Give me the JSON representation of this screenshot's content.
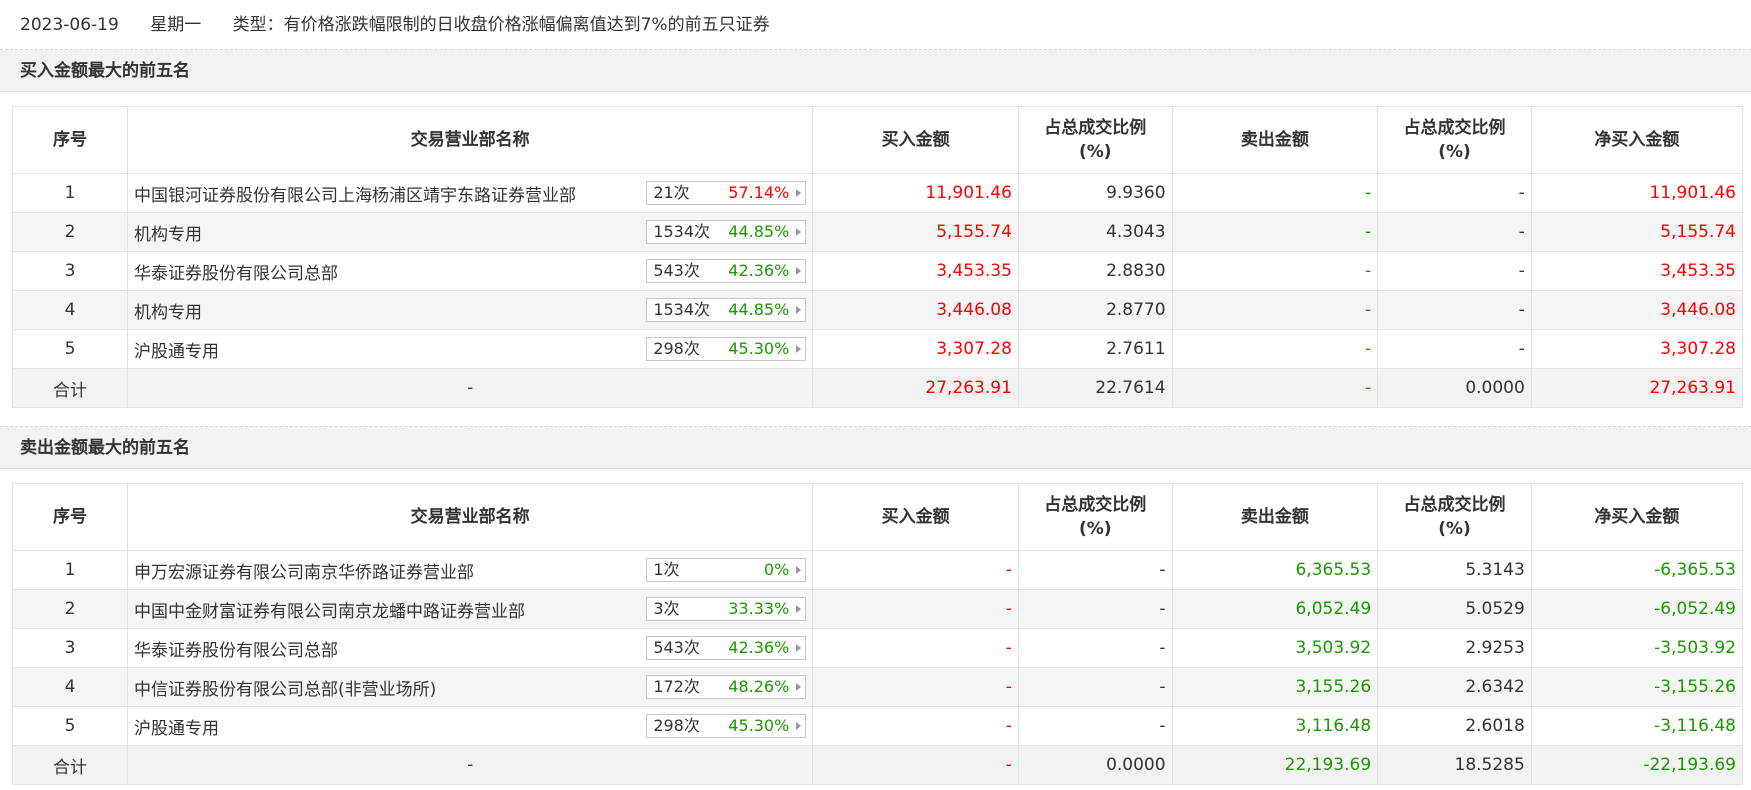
{
  "info": {
    "date": "2023-06-19",
    "weekday": "星期一",
    "type_text": "类型：有价格涨跌幅限制的日收盘价格涨幅偏离值达到7%的前五只证券"
  },
  "buy_section": {
    "title": "买入金额最大的前五名",
    "headers": [
      "序号",
      "交易营业部名称",
      "买入金额",
      "占总成交比例",
      "(%)",
      "卖出金额",
      "占总成交比例",
      "(%)",
      "净买入金额"
    ],
    "rows": [
      {
        "idx": "1",
        "name": "中国银河证券股份有限公司上海杨浦区靖宇东路证券营业部",
        "count": "21次",
        "pct": "57.14%",
        "pct_color": "red",
        "buy": "11,901.46",
        "buy_ratio": "9.9360",
        "sell": "-",
        "sell_ratio": "-",
        "net": "11,901.46"
      },
      {
        "idx": "2",
        "name": "机构专用",
        "count": "1534次",
        "pct": "44.85%",
        "pct_color": "green",
        "buy": "5,155.74",
        "buy_ratio": "4.3043",
        "sell": "-",
        "sell_ratio": "-",
        "net": "5,155.74"
      },
      {
        "idx": "3",
        "name": "华泰证券股份有限公司总部",
        "count": "543次",
        "pct": "42.36%",
        "pct_color": "green",
        "buy": "3,453.35",
        "buy_ratio": "2.8830",
        "sell": "-",
        "sell_ratio": "-",
        "net": "3,453.35"
      },
      {
        "idx": "4",
        "name": "机构专用",
        "count": "1534次",
        "pct": "44.85%",
        "pct_color": "green",
        "buy": "3,446.08",
        "buy_ratio": "2.8770",
        "sell": "-",
        "sell_ratio": "-",
        "net": "3,446.08"
      },
      {
        "idx": "5",
        "name": "沪股通专用",
        "count": "298次",
        "pct": "45.30%",
        "pct_color": "green",
        "buy": "3,307.28",
        "buy_ratio": "2.7611",
        "sell": "-",
        "sell_ratio": "-",
        "net": "3,307.28"
      }
    ],
    "total": {
      "label": "合计",
      "name": "-",
      "buy": "27,263.91",
      "buy_ratio": "22.7614",
      "sell": "-",
      "sell_ratio": "0.0000",
      "net": "27,263.91"
    }
  },
  "sell_section": {
    "title": "卖出金额最大的前五名",
    "headers": [
      "序号",
      "交易营业部名称",
      "买入金额",
      "占总成交比例",
      "(%)",
      "卖出金额",
      "占总成交比例",
      "(%)",
      "净买入金额"
    ],
    "rows": [
      {
        "idx": "1",
        "name": "申万宏源证券有限公司南京华侨路证券营业部",
        "count": "1次",
        "pct": "0%",
        "pct_color": "green",
        "buy": "-",
        "buy_ratio": "-",
        "sell": "6,365.53",
        "sell_ratio": "5.3143",
        "net": "-6,365.53"
      },
      {
        "idx": "2",
        "name": "中国中金财富证券有限公司南京龙蟠中路证券营业部",
        "count": "3次",
        "pct": "33.33%",
        "pct_color": "green",
        "buy": "-",
        "buy_ratio": "-",
        "sell": "6,052.49",
        "sell_ratio": "5.0529",
        "net": "-6,052.49"
      },
      {
        "idx": "3",
        "name": "华泰证券股份有限公司总部",
        "count": "543次",
        "pct": "42.36%",
        "pct_color": "green",
        "buy": "-",
        "buy_ratio": "-",
        "sell": "3,503.92",
        "sell_ratio": "2.9253",
        "net": "-3,503.92"
      },
      {
        "idx": "4",
        "name": "中信证券股份有限公司总部(非营业场所)",
        "count": "172次",
        "pct": "48.26%",
        "pct_color": "green",
        "buy": "-",
        "buy_ratio": "-",
        "sell": "3,155.26",
        "sell_ratio": "2.6342",
        "net": "-3,155.26"
      },
      {
        "idx": "5",
        "name": "沪股通专用",
        "count": "298次",
        "pct": "45.30%",
        "pct_color": "green",
        "buy": "-",
        "buy_ratio": "-",
        "sell": "3,116.48",
        "sell_ratio": "2.6018",
        "net": "-3,116.48"
      }
    ],
    "total": {
      "label": "合计",
      "name": "-",
      "buy": "-",
      "buy_ratio": "0.0000",
      "sell": "22,193.69",
      "sell_ratio": "18.5285",
      "net": "-22,193.69"
    }
  }
}
